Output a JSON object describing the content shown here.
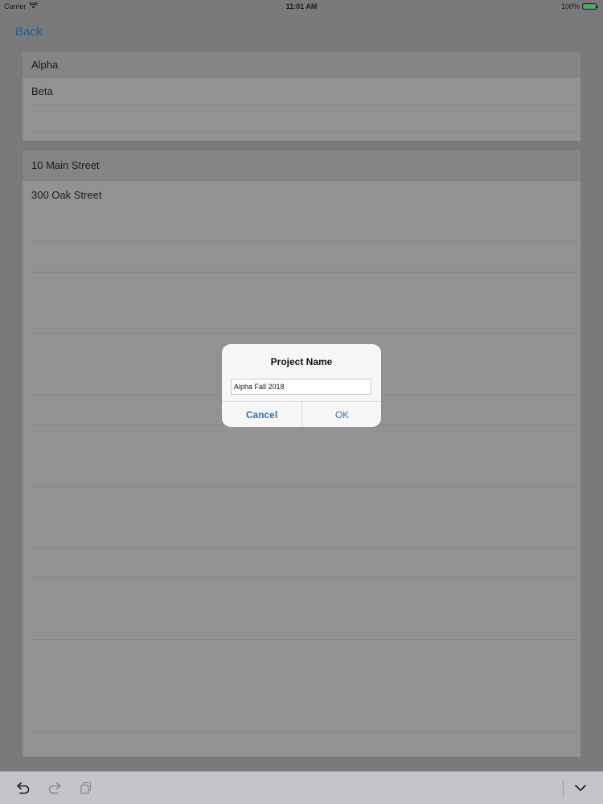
{
  "status_bar": {
    "carrier": "Carrier",
    "time": "11:01 AM",
    "battery": "100%",
    "wifi_icon": "wifi-icon",
    "battery_icon": "battery-icon",
    "battery_color": "#29c73e"
  },
  "nav": {
    "back_label": "Back",
    "accent_color": "#1f5f9c"
  },
  "projects_list": {
    "items": [
      {
        "label": "Alpha",
        "selected": true
      },
      {
        "label": "Beta",
        "selected": false
      },
      {
        "label": "",
        "selected": false
      }
    ]
  },
  "addresses_list": {
    "items": [
      {
        "label": "10 Main Street",
        "selected": true
      },
      {
        "label": "300 Oak Street",
        "selected": false
      }
    ]
  },
  "dialog": {
    "title": "Project Name",
    "input_value": "Alpha Fall 2018",
    "cancel_label": "Cancel",
    "ok_label": "OK"
  },
  "toolbar": {
    "undo_icon": "undo-icon",
    "redo_icon": "redo-icon",
    "paste_icon": "clipboard-icon",
    "dismiss_keyboard_icon": "chevron-down-icon"
  }
}
